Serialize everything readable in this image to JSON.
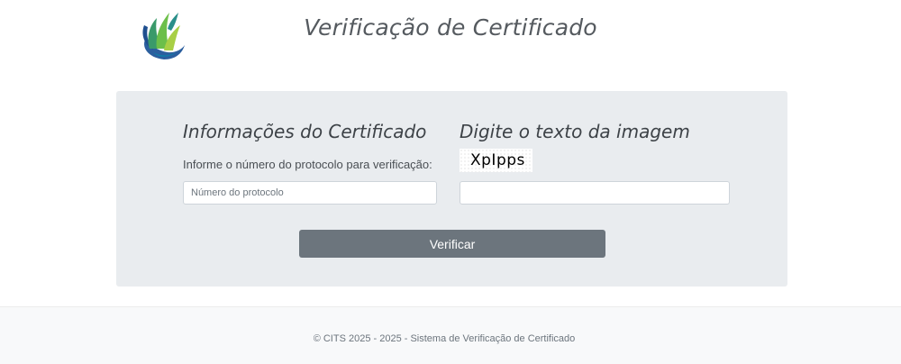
{
  "header": {
    "title": "Verificação de Certificado",
    "logo_icon": "leaf-flame-logo"
  },
  "certificate_section": {
    "heading": "Informações do Certificado",
    "helper_text": "Informe o número do protocolo para verificação:",
    "protocol_input": {
      "placeholder": "Número do protocolo",
      "value": ""
    }
  },
  "captcha_section": {
    "heading": "Digite o texto da imagem",
    "captcha_text": "XpIpps",
    "captcha_input": {
      "placeholder": "",
      "value": ""
    }
  },
  "actions": {
    "verify_label": "Verificar"
  },
  "footer": {
    "text": "© CITS 2025 - 2025 - Sistema de Verificação de Certificado"
  },
  "colors": {
    "panel_background": "#e9ecef",
    "button_background": "#6c757d",
    "footer_background": "#f8f9fa"
  }
}
